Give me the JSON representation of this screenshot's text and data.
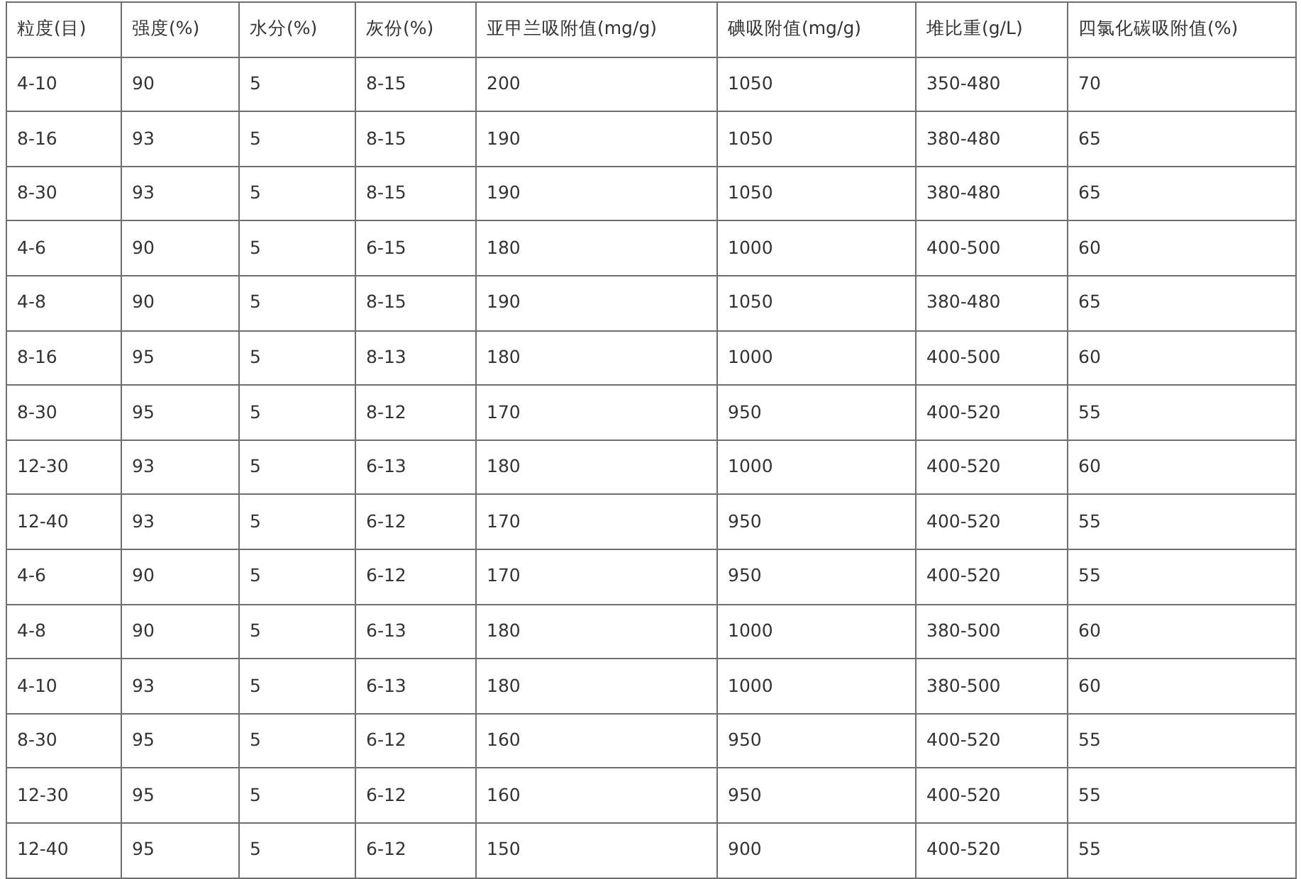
{
  "table": {
    "columns": [
      "粒度(目)",
      "强度(%)",
      "水分(%)",
      "灰份(%)",
      "亚甲兰吸附值(mg/g)",
      "碘吸附值(mg/g)",
      "堆比重(g/L)",
      "四氯化碳吸附值(%)"
    ],
    "rows": [
      [
        "4-10",
        "90",
        "5",
        "8-15",
        "200",
        "1050",
        "350-480",
        "70"
      ],
      [
        "8-16",
        "93",
        "5",
        "8-15",
        "190",
        "1050",
        "380-480",
        "65"
      ],
      [
        "8-30",
        "93",
        "5",
        "8-15",
        "190",
        "1050",
        "380-480",
        "65"
      ],
      [
        "4-6",
        "90",
        "5",
        "6-15",
        "180",
        "1000",
        "400-500",
        "60"
      ],
      [
        "4-8",
        "90",
        "5",
        "8-15",
        "190",
        "1050",
        "380-480",
        "65"
      ],
      [
        "8-16",
        "95",
        "5",
        "8-13",
        "180",
        "1000",
        "400-500",
        "60"
      ],
      [
        "8-30",
        "95",
        "5",
        "8-12",
        "170",
        "950",
        "400-520",
        "55"
      ],
      [
        "12-30",
        "93",
        "5",
        "6-13",
        "180",
        "1000",
        "400-520",
        "60"
      ],
      [
        "12-40",
        "93",
        "5",
        "6-12",
        "170",
        "950",
        "400-520",
        "55"
      ],
      [
        "4-6",
        "90",
        "5",
        "6-12",
        "170",
        "950",
        "400-520",
        "55"
      ],
      [
        "4-8",
        "90",
        "5",
        "6-13",
        "180",
        "1000",
        "380-500",
        "60"
      ],
      [
        "4-10",
        "93",
        "5",
        "6-13",
        "180",
        "1000",
        "380-500",
        "60"
      ],
      [
        "8-30",
        "95",
        "5",
        "6-12",
        "160",
        "950",
        "400-520",
        "55"
      ],
      [
        "12-30",
        "95",
        "5",
        "6-12",
        "160",
        "950",
        "400-520",
        "55"
      ],
      [
        "12-40",
        "95",
        "5",
        "6-12",
        "150",
        "900",
        "400-520",
        "55"
      ]
    ]
  }
}
